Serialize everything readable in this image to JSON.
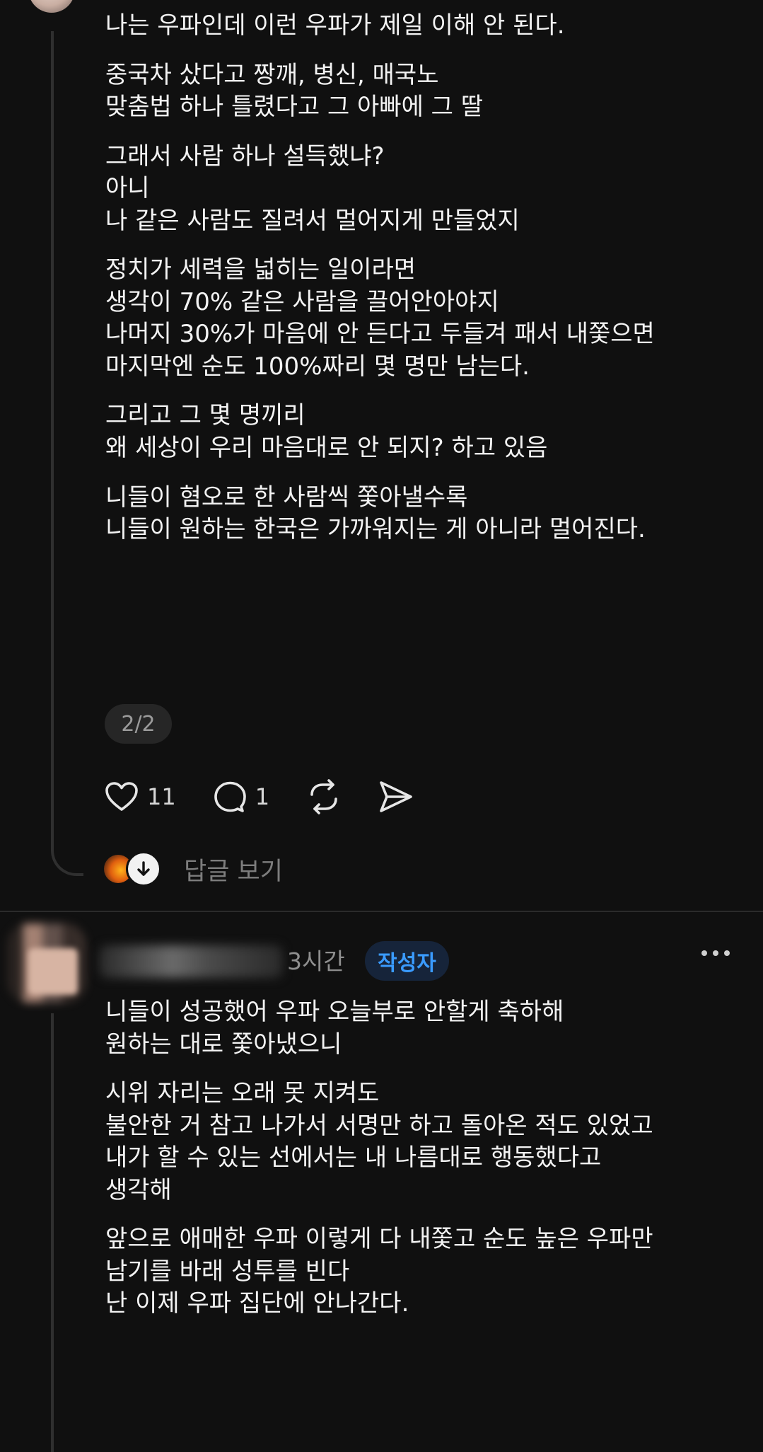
{
  "post": {
    "paragraphs": [
      [
        "나는 우파인데 이런 우파가 제일 이해 안 된다."
      ],
      [
        "중국차 샀다고 짱깨, 병신, 매국노",
        "맞춤법 하나 틀렸다고 그 아빠에 그 딸"
      ],
      [
        "그래서 사람 하나 설득했냐?",
        "아니",
        "나 같은 사람도 질려서 멀어지게 만들었지"
      ],
      [
        "정치가 세력을 넓히는 일이라면",
        "생각이 70% 같은 사람을 끌어안아야지",
        "나머지 30%가 마음에 안 든다고 두들겨 패서 내쫓으면",
        "마지막엔 순도 100%짜리 몇 명만 남는다."
      ],
      [
        "그리고 그 몇 명끼리",
        "왜 세상이 우리 마음대로 안 되지? 하고 있음"
      ],
      [
        "니들이 혐오로 한 사람씩 쫓아낼수록",
        "니들이 원하는 한국은 가까워지는 게 아니라 멀어진다."
      ]
    ],
    "page_indicator": "2/2",
    "likes": "11",
    "comments": "1",
    "replies_label": "답글 보기"
  },
  "reply": {
    "time": "3시간",
    "badge": "작성자",
    "paragraphs": [
      [
        "니들이 성공했어 우파 오늘부로 안할게 축하해",
        "원하는 대로 쫓아냈으니"
      ],
      [
        "시위 자리는 오래 못 지켜도",
        "불안한 거 참고 나가서 서명만 하고 돌아온 적도 있었고",
        "내가 할 수 있는 선에서는 내 나름대로 행동했다고",
        "생각해"
      ],
      [
        "앞으로 애매한 우파 이렇게 다 내쫓고 순도 높은 우파만",
        "남기를 바래 성투를 빈다",
        "난 이제 우파 집단에 안나간다."
      ]
    ]
  },
  "icons": {
    "like": "heart-icon",
    "comment": "comment-bubble-icon",
    "repost": "repost-icon",
    "share": "send-icon",
    "more": "more-dots-icon",
    "expand": "arrow-down-icon"
  },
  "colors": {
    "background": "#101010",
    "text": "#f3f3f3",
    "muted": "#7d7d7d",
    "badge_text": "#3a9bff",
    "badge_bg": "#16243a"
  }
}
